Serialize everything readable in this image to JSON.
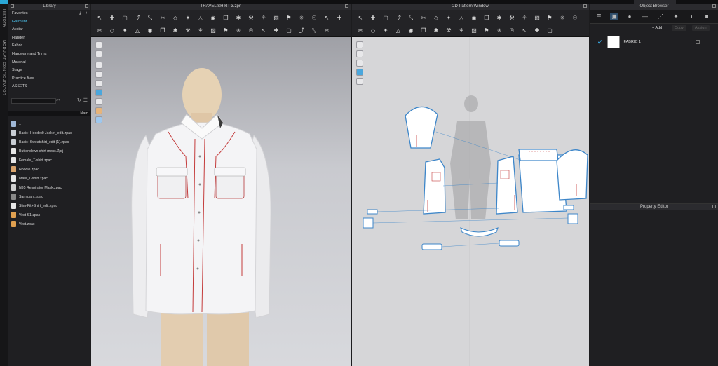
{
  "side_tabs": {
    "history": "HISTORY",
    "modular": "MODULAR CONFIGURATOR"
  },
  "library": {
    "title": "Library",
    "nav": [
      {
        "label": "Favorites",
        "selected": false
      },
      {
        "label": "Garment",
        "selected": true
      },
      {
        "label": "Avatar",
        "selected": false
      },
      {
        "label": "Hanger",
        "selected": false
      },
      {
        "label": "Fabric",
        "selected": false
      },
      {
        "label": "Hardware and Trims",
        "selected": false
      },
      {
        "label": "Material",
        "selected": false
      },
      {
        "label": "Stage",
        "selected": false
      },
      {
        "label": "Practice files",
        "selected": false
      },
      {
        "label": "ASSETS",
        "selected": false
      }
    ],
    "column_header": "Nam",
    "files": [
      {
        "name": "..",
        "icon": "folder-up-icon"
      },
      {
        "name": "Basic+Hooded+Jacket_edit.zpac",
        "icon": "jacket-icon"
      },
      {
        "name": "Basic+Sweatshirt_edit (1).zpac",
        "icon": "sweatshirt-icon"
      },
      {
        "name": "Buttondown shirt mens.Zprj",
        "icon": "shirt-icon"
      },
      {
        "name": "Female_T-shirt.zpac",
        "icon": "tshirt-icon"
      },
      {
        "name": "Hoodie.zpac",
        "icon": "hoodie-icon"
      },
      {
        "name": "Male_T-shirt.zpac",
        "icon": "tshirt-icon"
      },
      {
        "name": "N95 Respirator Mask.zpac",
        "icon": "mask-icon"
      },
      {
        "name": "Sam pant.zpac",
        "icon": "pants-icon"
      },
      {
        "name": "Slim-Fit+Shirt_edit.zpac",
        "icon": "shirt-icon"
      },
      {
        "name": "Vest S1.zpac",
        "icon": "vest-icon"
      },
      {
        "name": "Vest.zpac",
        "icon": "vest-icon"
      }
    ]
  },
  "window3d": {
    "title": "TRAVEL SHIRT 3.zprj"
  },
  "window2d": {
    "title": "2D Pattern Window"
  },
  "object_browser": {
    "title": "Object Browser",
    "add_label": "+ Add",
    "copy_label": "Copy",
    "assign_label": "Assign",
    "fabric_name": "FABRIC 1",
    "accent": "#39a9e4"
  },
  "property_editor": {
    "title": "Property Editor"
  }
}
